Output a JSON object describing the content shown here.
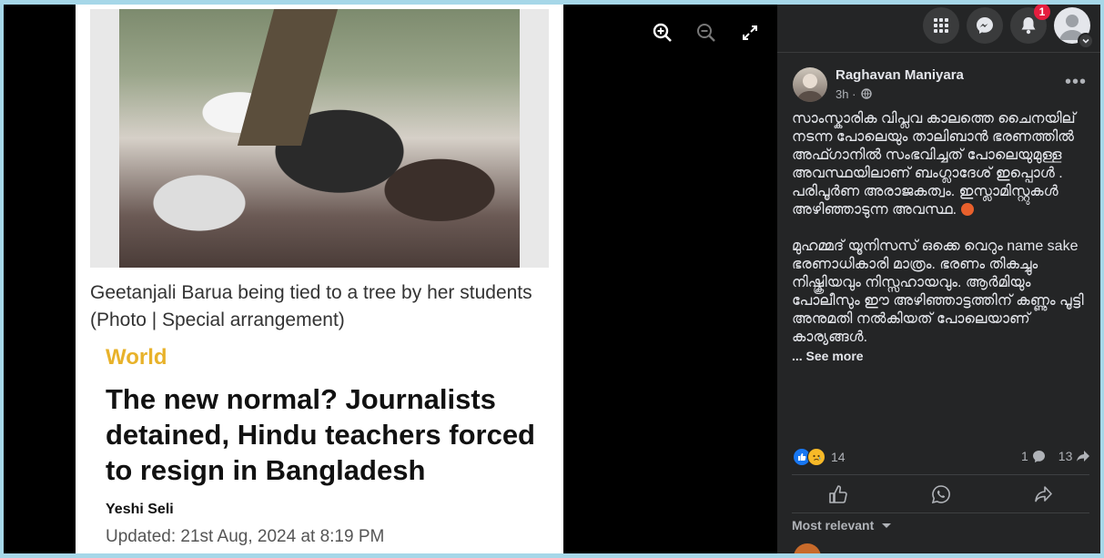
{
  "viewer": {
    "caption": "Geetanjali Barua being tied to a tree by her students (Photo | Special arrangement)",
    "section": "World",
    "headline": "The new normal? Journalists detained, Hindu teachers forced to resign in Bangladesh",
    "byline": "Yeshi Seli",
    "updated": "Updated: 21st Aug, 2024 at 8:19 PM",
    "tools": [
      "zoom-in-icon",
      "zoom-out-icon",
      "fullscreen-icon"
    ]
  },
  "topbar": {
    "notification_count": "1",
    "icons": [
      "menu-grid-icon",
      "messenger-icon",
      "bell-icon"
    ]
  },
  "post": {
    "author": "Raghavan Maniyara",
    "time": "3h ·",
    "paragraph1": "സാംസ്കാരിക വിപ്ലവ കാലത്തെ ചൈനയില് നടന്ന പോലെയും താലിബാൻ ഭരണത്തിൽ അഫ്ഗാനിൽ സംഭവിച്ചത് പോലെയുമുള്ള അവസ്ഥയിലാണ് ബംഗ്ലാദേശ് ഇപ്പൊൾ . പരിപൂർണ അരാജകത്വം. ഇസ്ലാമിസ്റ്റുകൾ അഴിഞ്ഞാടുന്ന അവസ്ഥ.",
    "paragraph2": "മുഹമ്മദ് യൂനിസസ് ഒക്കെ വെറും name sake ഭരണാധികാരി മാത്രം. ഭരണം തികച്ചും നിഷ്ക്രിയവും നിസ്സഹായവും. ആർമിയും പോലീസും ഈ അഴിഞ്ഞാട്ടത്തിന് കണ്ണും പൂട്ടി അനുമതി നൽകിയത് പോലെയാണ് കാര്യങ്ങൾ.",
    "see_more": "... See more",
    "reaction_count": "14",
    "comment_count": "1",
    "share_count": "13",
    "sort_label": "Most relevant"
  }
}
